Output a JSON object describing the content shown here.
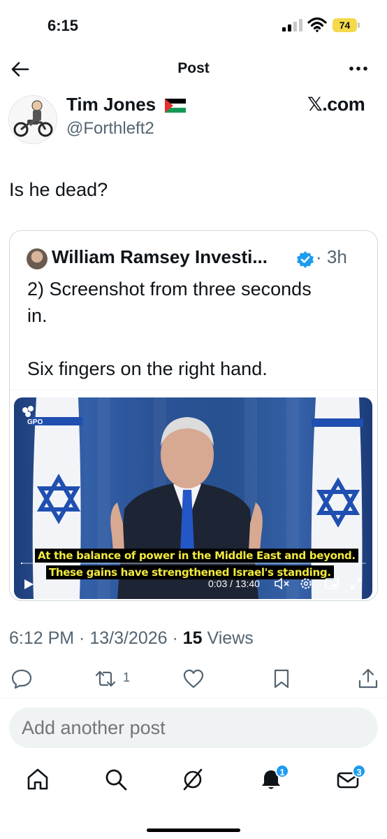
{
  "status_bar": {
    "time": "6:15",
    "battery": "74"
  },
  "header": {
    "title": "Post"
  },
  "author": {
    "name": "Tim Jones",
    "handle": "@Forthleft2",
    "source": "𝕏.com"
  },
  "post": {
    "text": "Is he dead?"
  },
  "quote": {
    "author": "William Ramsey Investi...",
    "time": "· 3h",
    "line1": "2) Screenshot from three seconds",
    "line2": "in.",
    "line3": "Six fingers on the right hand."
  },
  "video": {
    "logo": "GPO",
    "caption_line1": "At the balance of power in the Middle East and beyond.",
    "caption_line2": "These gains have strengthened Israel's standing.",
    "time": "0:03 / 13:40",
    "progress": 0.004
  },
  "meta": {
    "time": "6:12 PM · 13/3/2026 · ",
    "views_count": "15",
    "views_label": " Views"
  },
  "actions": {
    "repost_count": "1"
  },
  "reply": {
    "placeholder": "Add another post"
  },
  "tabs": {
    "notifications_badge": "1",
    "messages_badge": "3"
  },
  "colors": {
    "accent": "#1d9bf0",
    "text": "#0f1419",
    "muted": "#536471",
    "caption": "#f2ea3c"
  },
  "icons": [
    "back-arrow-icon",
    "more-icon",
    "palestine-flag-icon",
    "verified-badge-icon",
    "play-icon",
    "mute-icon",
    "settings-icon",
    "pip-icon",
    "expand-icon",
    "reply-icon",
    "repost-icon",
    "like-icon",
    "bookmark-icon",
    "share-icon",
    "home-icon",
    "search-icon",
    "grok-icon",
    "notifications-icon",
    "messages-icon"
  ]
}
